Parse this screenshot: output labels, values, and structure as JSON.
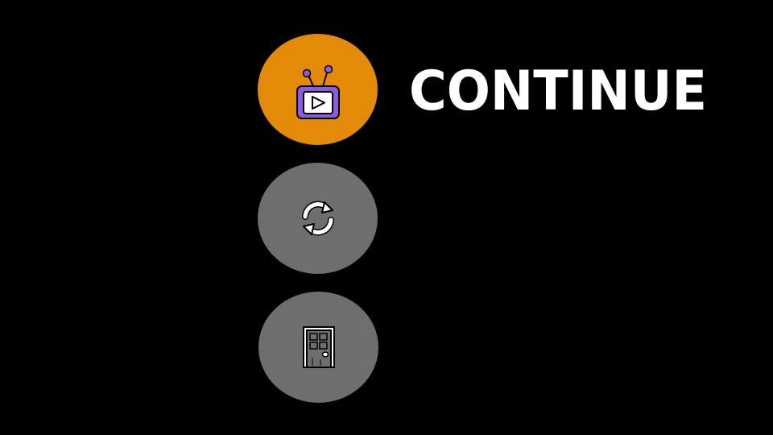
{
  "menu": {
    "selected_label": "CONTINUE",
    "items": [
      {
        "id": "continue",
        "icon": "tv-play-icon",
        "color": "#E38A08",
        "selected": true
      },
      {
        "id": "restart",
        "icon": "refresh-icon",
        "color": "#6E6E6E",
        "selected": false
      },
      {
        "id": "quit",
        "icon": "door-icon",
        "color": "#6E6E6E",
        "selected": false
      }
    ]
  },
  "colors": {
    "background": "#000000",
    "selected": "#E38A08",
    "unselected": "#6E6E6E",
    "tv_purple": "#8C5BE0",
    "label": "#FFFFFF"
  }
}
